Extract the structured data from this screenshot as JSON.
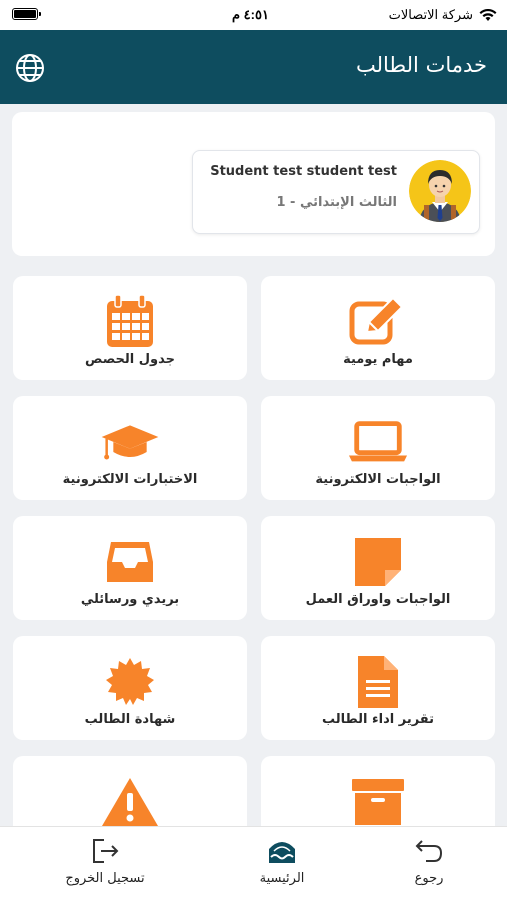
{
  "status_bar": {
    "carrier": "شركة الاتصالات",
    "time": "٤:٥١ م"
  },
  "header": {
    "title": "خدمات الطالب"
  },
  "profile": {
    "name": "Student test student test",
    "grade": "الثالث الإبتدائي - 1"
  },
  "tiles": [
    {
      "label": "مهام يومية",
      "icon": "edit-icon"
    },
    {
      "label": "جدول الحصص",
      "icon": "calendar-icon"
    },
    {
      "label": "الواجبات الالكترونية",
      "icon": "laptop-icon"
    },
    {
      "label": "الاختبارات الالكترونية",
      "icon": "graduation-cap-icon"
    },
    {
      "label": "الواجبات واوراق العمل",
      "icon": "sticky-note-icon"
    },
    {
      "label": "بريدي ورسائلي",
      "icon": "inbox-icon"
    },
    {
      "label": "تقرير اداء الطالب",
      "icon": "document-icon"
    },
    {
      "label": "شهادة الطالب",
      "icon": "certificate-icon"
    },
    {
      "label": "",
      "icon": "archive-box-icon"
    },
    {
      "label": "",
      "icon": "warning-icon"
    }
  ],
  "bottom_nav": {
    "logout": "تسجيل الخروج",
    "home": "الرئيسية",
    "back": "رجوع"
  },
  "colors": {
    "header": "#0e4d5f",
    "accent": "#f7842a",
    "background": "#eef0f3"
  }
}
